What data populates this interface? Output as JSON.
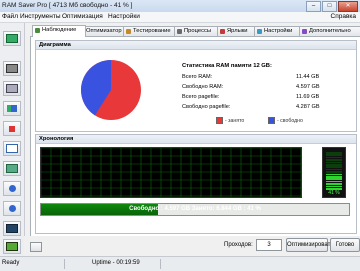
{
  "window": {
    "title": "RAM Saver Pro [ 4713 Мб свободно - 41 % ]",
    "btn_min": "–",
    "btn_max": "□",
    "btn_close": "✕"
  },
  "menu": {
    "items": [
      "Файл",
      "Инструменты",
      "Оптимизация",
      "Настройки"
    ],
    "help": "Справка"
  },
  "toolbar": {
    "icons": [
      "monitor-icon",
      "chip-icon",
      "drive-icon",
      "chart-icon",
      "tools-icon",
      "page-icon",
      "settings-icon",
      "info-icon",
      "power-icon",
      "window-icon",
      "exit-icon"
    ]
  },
  "tabs": [
    {
      "label": "Наблюдение",
      "active": true,
      "color": "#4a8a3a"
    },
    {
      "label": "Оптимизатор",
      "active": false,
      "color": "#3a6fc4"
    },
    {
      "label": "Тестирование",
      "active": false,
      "color": "#c48a2a"
    },
    {
      "label": "Процессы",
      "active": false,
      "color": "#6a6a6a"
    },
    {
      "label": "Ярлыки",
      "active": false,
      "color": "#c43a3a"
    },
    {
      "label": "Настройки",
      "active": false,
      "color": "#3a9ac4"
    },
    {
      "label": "Дополнительно",
      "active": false,
      "color": "#8a4ac4"
    }
  ],
  "diagram": {
    "heading": "Диаграмма",
    "stats_title": "Статистика RAM памяти 12 GB:",
    "rows": [
      {
        "label": "Всего RAM:",
        "value": "11.44 GB"
      },
      {
        "label": "Свободно RAM:",
        "value": "4.597 GB"
      },
      {
        "label": "Всего pagefile:",
        "value": "11.69 GB"
      },
      {
        "label": "Свободно pagefile:",
        "value": "4.287 GB"
      }
    ],
    "legend_busy": "- занято",
    "legend_free": "- свободно",
    "busy_color": "#e8383a",
    "free_color": "#3a52e0",
    "free_fraction": 0.41
  },
  "chronology": {
    "heading": "Хронология",
    "meter_percent": "41 %",
    "bar_text": "Свободно : 4.597 GB   Занято: 6.844 GB : 41 %",
    "bar_fraction": 0.38
  },
  "bottom": {
    "passes_label": "Проходов:",
    "passes_value": "3",
    "optimize_button": "Оптимизировать",
    "done_button": "Готово"
  },
  "status": {
    "left": "Ready",
    "uptime": "Uptime - 00:19:59"
  }
}
